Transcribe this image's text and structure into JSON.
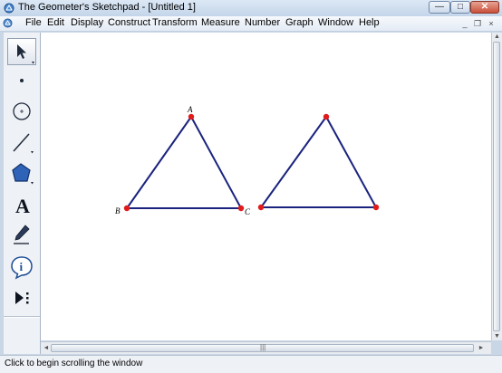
{
  "window": {
    "title": "The Geometer's Sketchpad - [Untitled 1]",
    "min_glyph": "—",
    "max_glyph": "□",
    "close_glyph": "✕"
  },
  "menu": {
    "items": [
      "File",
      "Edit",
      "Display",
      "Construct",
      "Transform",
      "Measure",
      "Number",
      "Graph",
      "Window",
      "Help"
    ],
    "mdi_min": "_",
    "mdi_restore": "❐",
    "mdi_close": "×"
  },
  "toolbox": {
    "tools": [
      {
        "name": "arrow-tool",
        "icon": "arrow-pointer-icon",
        "selected": true
      },
      {
        "name": "point-tool",
        "icon": "point-icon"
      },
      {
        "name": "compass-tool",
        "icon": "compass-circle-icon"
      },
      {
        "name": "straightedge-tool",
        "icon": "line-segment-icon"
      },
      {
        "name": "polygon-tool",
        "icon": "pentagon-icon"
      },
      {
        "name": "text-tool",
        "icon": "letter-a-icon",
        "glyph": "A"
      },
      {
        "name": "marker-tool",
        "icon": "pen-icon"
      },
      {
        "name": "information-tool",
        "icon": "info-icon",
        "glyph": "i"
      },
      {
        "name": "custom-tool",
        "icon": "play-menu-icon"
      }
    ]
  },
  "sketch": {
    "label_A": "A",
    "label_B": "B",
    "label_C": "C",
    "line_color": "#1a237e",
    "point_color": "#e01b1b"
  },
  "scrollbar": {
    "grip": "|||",
    "up": "▲",
    "down": "▼",
    "left": "◄",
    "right": "►"
  },
  "status": {
    "text": "Click to begin scrolling the window"
  }
}
